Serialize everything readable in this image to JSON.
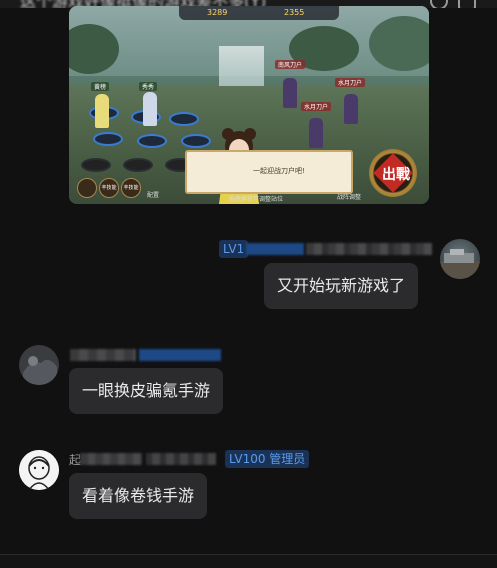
{
  "window": {
    "title_blurred": "这个游戏好像挺像的游戏差不多(Y)"
  },
  "game_screenshot": {
    "hud_left_value": "3289",
    "hud_right_value": "2355",
    "dialog_text": "一起迎战刀户吧!",
    "fight_button": "出戰",
    "bottom_hint": "拖拽换将可调整站位",
    "bottom_right_label": "战阵调整",
    "config_label": "配置",
    "hero_tags": [
      "黄榜",
      "秀秀"
    ],
    "enemy_tags": [
      "南风刀户",
      "水月刀户",
      "水月刀户"
    ],
    "circles": [
      "",
      "丰技能",
      "丰技能"
    ]
  },
  "messages": [
    {
      "side": "right",
      "level_badge": "LV1",
      "text": "又开始玩新游戏了"
    },
    {
      "side": "left",
      "text": "一眼换皮骗氪手游"
    },
    {
      "side": "left",
      "name_prefix": "起",
      "level_badge": "LV100 管理员",
      "text": "看着像卷钱手游"
    }
  ],
  "colors": {
    "background": "#111112",
    "bubble": "#2b2b2d",
    "badge_bg": "#1a3255",
    "badge_text": "#5b9bea"
  }
}
